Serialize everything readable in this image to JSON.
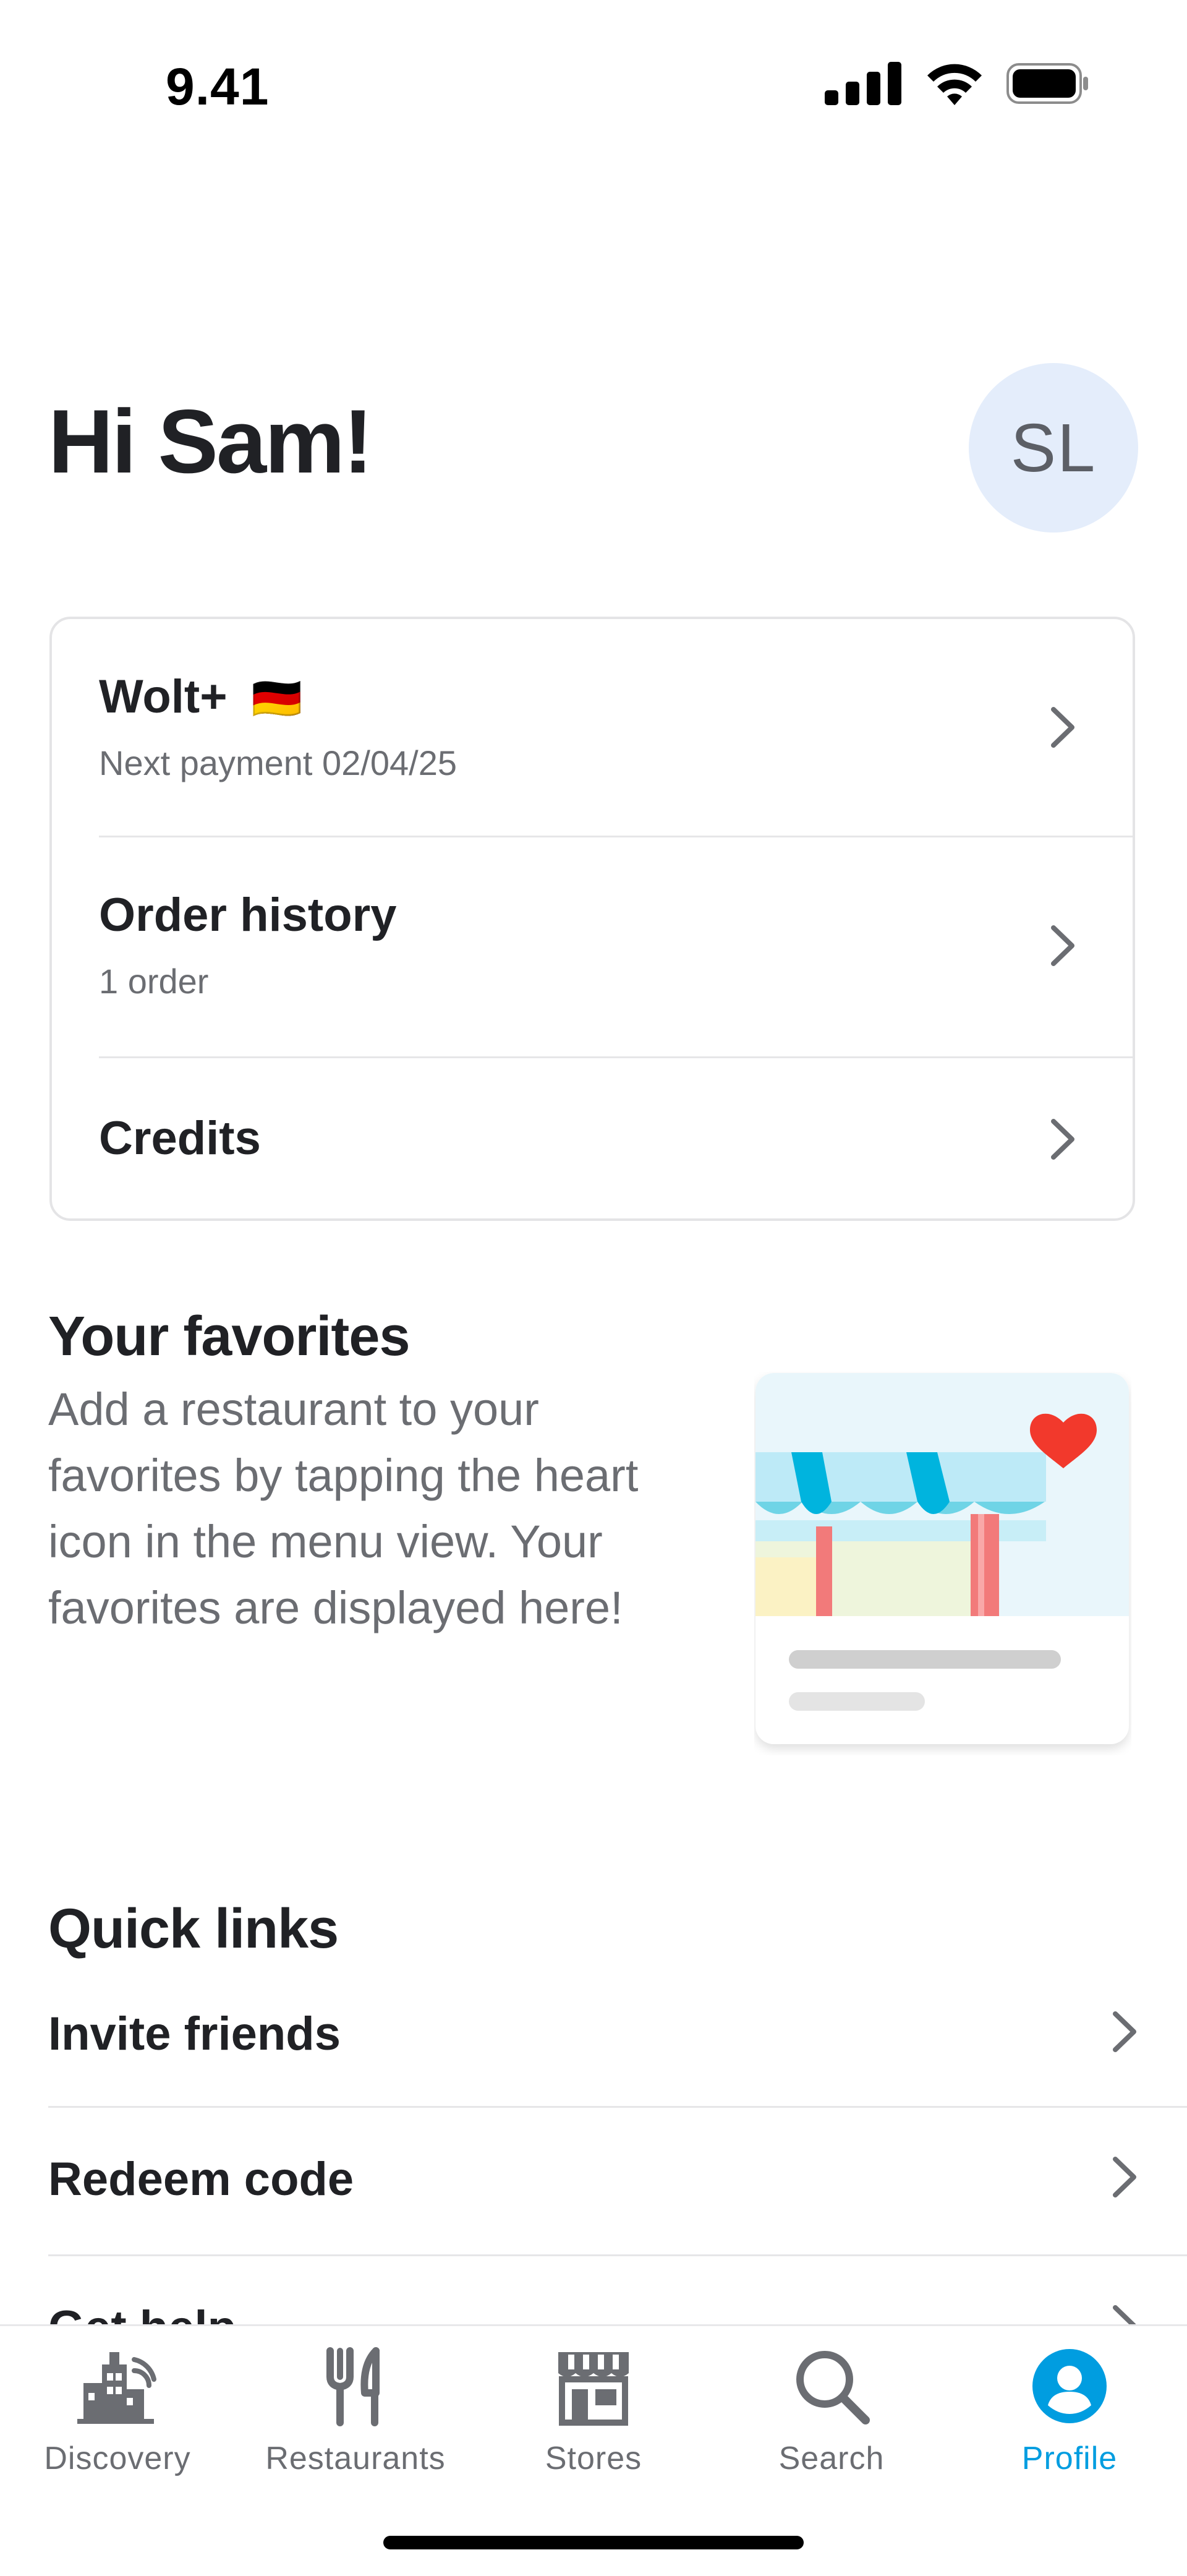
{
  "status_bar": {
    "time": "9.41"
  },
  "header": {
    "greeting": "Hi Sam!",
    "avatar_initials": "SL"
  },
  "account_card": {
    "items": [
      {
        "title": "Wolt+",
        "flag": "🇩🇪",
        "subtitle": "Next payment 02/04/25"
      },
      {
        "title": "Order history",
        "subtitle": "1 order"
      },
      {
        "title": "Credits"
      }
    ]
  },
  "favorites": {
    "title": "Your favorites",
    "description": "Add a restaurant to your favorites by tapping the heart icon in the menu view. Your favorites are displayed here!"
  },
  "quick_links": {
    "title": "Quick links",
    "items": [
      {
        "label": "Invite friends"
      },
      {
        "label": "Redeem code"
      },
      {
        "label": "Get help"
      }
    ]
  },
  "bottom_nav": {
    "items": [
      {
        "label": "Discovery",
        "icon": "discovery-icon"
      },
      {
        "label": "Restaurants",
        "icon": "restaurants-icon"
      },
      {
        "label": "Stores",
        "icon": "stores-icon"
      },
      {
        "label": "Search",
        "icon": "search-icon"
      },
      {
        "label": "Profile",
        "icon": "profile-icon",
        "active": true
      }
    ]
  },
  "colors": {
    "accent": "#009de0",
    "avatar_bg": "#e4edfb",
    "heart": "#f2392c",
    "text": "#202125",
    "muted": "#6b6d72"
  }
}
